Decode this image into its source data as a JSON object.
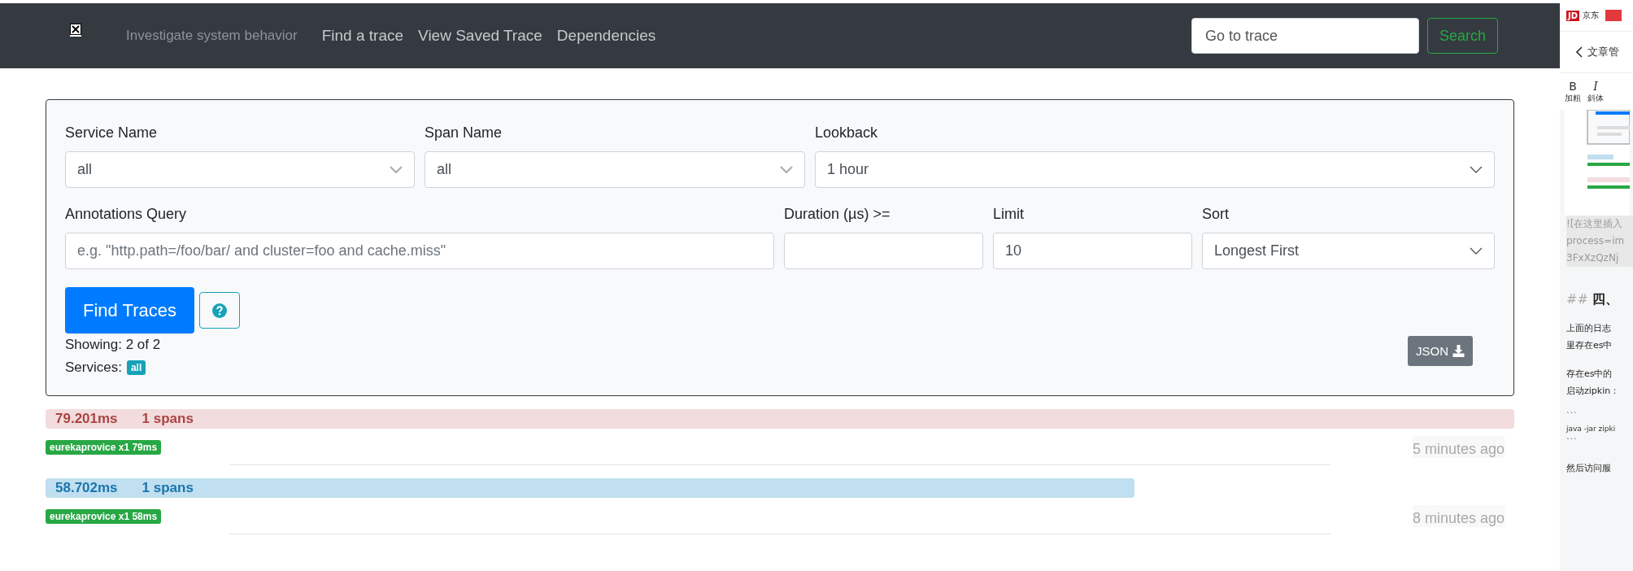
{
  "header": {
    "tagline": "Investigate system behavior",
    "nav": [
      {
        "label": "Find a trace"
      },
      {
        "label": "View Saved Trace"
      },
      {
        "label": "Dependencies"
      }
    ],
    "search": {
      "placeholder": "Go to trace"
    },
    "search_button": "Search"
  },
  "form": {
    "row_1": [
      {
        "label": "Service Name",
        "kind": "select",
        "value": "all"
      },
      {
        "label": "Span Name",
        "kind": "select",
        "value": "all"
      },
      {
        "label": "Lookback",
        "kind": "select",
        "value": "1 hour"
      }
    ],
    "row_2": [
      {
        "label": "Annotations Query",
        "kind": "input",
        "placeholder": "e.g. \"http.path=/foo/bar/ and cluster=foo and cache.miss\""
      },
      {
        "label": "Duration (µs) >=",
        "kind": "input"
      },
      {
        "label": "Limit",
        "kind": "input",
        "value": "10"
      },
      {
        "label": "Sort",
        "kind": "select",
        "value": "Longest First"
      }
    ],
    "find_button": "Find Traces",
    "showing": "Showing: 2 of 2",
    "services_label": "Services:",
    "services_badge": "all",
    "json_button": "JSON"
  },
  "traces": [
    {
      "kind": "danger",
      "duration": "79.201ms",
      "spans": "1 spans",
      "tag": "eurekaprovice x1 79ms",
      "time": "5 minutes ago"
    },
    {
      "kind": "info",
      "duration": "58.702ms",
      "spans": "1 spans",
      "tag": "eurekaprovice x1 58ms",
      "time": "8 minutes ago"
    }
  ],
  "side_panel": {
    "logo": "JD",
    "brand": "京东",
    "title": "文章管",
    "tools": [
      {
        "glyph": "B",
        "label": "加粗"
      },
      {
        "glyph": "I",
        "label": "斜体"
      }
    ],
    "blocks": [
      {
        "kind": "picture"
      },
      {
        "kind": "markdown",
        "lines": [
          "![在这里插入",
          "process=im",
          "3FxXzQzNj"
        ]
      },
      {
        "kind": "heading",
        "mark": "##",
        "text": "四、"
      },
      {
        "kind": "paragraph",
        "lines": [
          "上面的日志",
          "里存在es中"
        ]
      },
      {
        "kind": "paragraph",
        "lines": [
          "存在es中的",
          "启动zipkin："
        ]
      },
      {
        "kind": "code",
        "lines": [
          "```",
          "java -jar zipki",
          "```"
        ]
      },
      {
        "kind": "paragraph",
        "lines": [
          "然后访问服"
        ]
      }
    ]
  }
}
